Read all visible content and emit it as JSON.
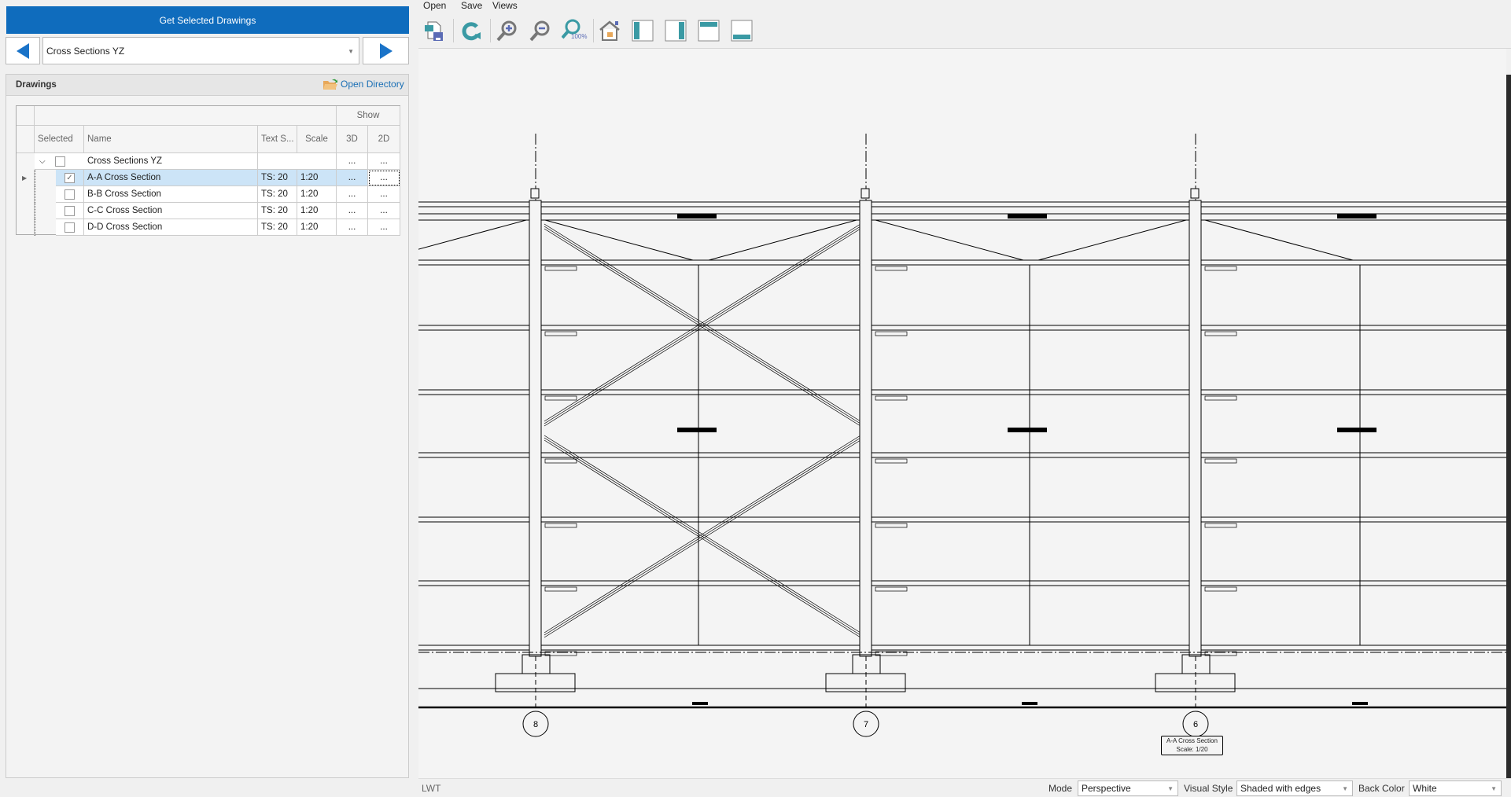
{
  "left": {
    "get_button": "Get Selected Drawings",
    "combo_value": "Cross Sections YZ",
    "panel_title": "Drawings",
    "open_directory": "Open Directory",
    "grid": {
      "group_header": "Show",
      "columns": [
        "Selected",
        "Name",
        "Text S...",
        "Scale",
        "3D",
        "2D"
      ],
      "group_row": {
        "name": "Cross Sections YZ",
        "d3": "...",
        "d2": "..."
      },
      "rows": [
        {
          "checked": true,
          "name": "A-A Cross Section",
          "ts": "TS: 20",
          "scale": "1:20",
          "d3": "...",
          "d2": "..."
        },
        {
          "checked": false,
          "name": "B-B Cross Section",
          "ts": "TS: 20",
          "scale": "1:20",
          "d3": "...",
          "d2": "..."
        },
        {
          "checked": false,
          "name": "C-C Cross Section",
          "ts": "TS: 20",
          "scale": "1:20",
          "d3": "...",
          "d2": "..."
        },
        {
          "checked": false,
          "name": "D-D Cross Section",
          "ts": "TS: 20",
          "scale": "1:20",
          "d3": "...",
          "d2": "..."
        }
      ]
    }
  },
  "menu": [
    "Open",
    "Save",
    "Views"
  ],
  "toolbar": [
    "save-image",
    "refresh",
    "zoom-in",
    "zoom-out",
    "zoom-100",
    "home",
    "view-left",
    "view-right",
    "view-top",
    "view-bottom"
  ],
  "zoom100_label": "100%",
  "drawing": {
    "grid_bubbles": [
      "8",
      "7",
      "6"
    ],
    "title_line1": "A-A Cross Section",
    "title_line2": "Scale: 1/20"
  },
  "status": {
    "lwt": "LWT",
    "mode_label": "Mode",
    "mode_value": "Perspective",
    "style_label": "Visual Style",
    "style_value": "Shaded with edges",
    "back_label": "Back Color",
    "back_value": "White"
  },
  "colors": {
    "accent": "#0f6cbd",
    "selected_row": "#cce4f7",
    "arrow": "#1a73c8"
  }
}
